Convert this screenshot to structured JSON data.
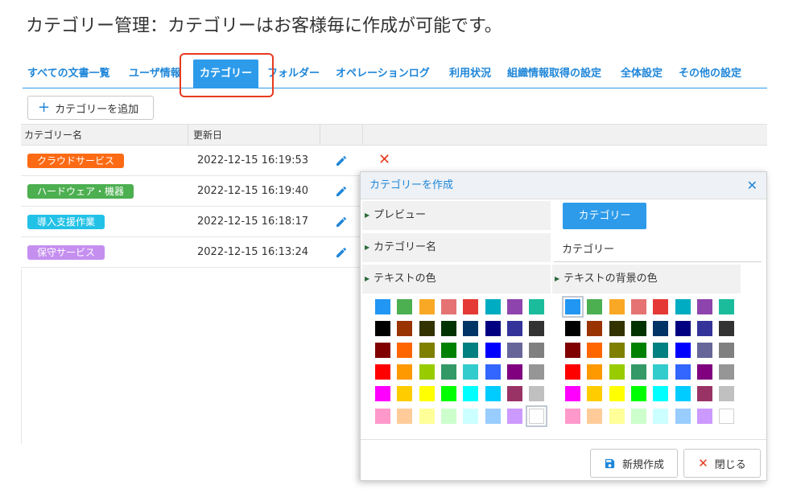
{
  "page": {
    "title": "カテゴリー管理：カテゴリーはお客様毎に作成が可能です。"
  },
  "nav": {
    "tabs": [
      {
        "label": "すべての文書一覧"
      },
      {
        "label": "ユーザ情報"
      },
      {
        "label": "カテゴリー",
        "active": true
      },
      {
        "label": "フォルダー"
      },
      {
        "label": "オペレーションログ"
      },
      {
        "label": "利用状況"
      },
      {
        "label": "組織情報取得の設定"
      },
      {
        "label": "全体設定"
      },
      {
        "label": "その他の設定"
      }
    ]
  },
  "toolbar": {
    "add_label": "カテゴリーを追加",
    "add_icon": "plus-icon"
  },
  "table": {
    "columns": [
      "カテゴリー名",
      "更新日"
    ],
    "rows": [
      {
        "name": "クラウドサービス",
        "color": "#fd6a14",
        "updated": "2022-12-15 16:19:53"
      },
      {
        "name": "ハードウェア・機器",
        "color": "#4caf50",
        "updated": "2022-12-15 16:19:40"
      },
      {
        "name": "導入支援作業",
        "color": "#22c1e6",
        "updated": "2022-12-15 16:18:17"
      },
      {
        "name": "保守サービス",
        "color": "#c58ff0",
        "updated": "2022-12-15 16:13:24"
      }
    ],
    "icons": {
      "edit": "pencil-icon",
      "delete": "close-icon"
    }
  },
  "dialog": {
    "title": "カテゴリーを作成",
    "close_icon": "close-icon",
    "preview_label": "プレビュー",
    "preview_value": "カテゴリー",
    "name_label": "カテゴリー名",
    "name_value": "カテゴリー",
    "text_color_label": "テキストの色",
    "bg_color_label": "テキストの背景の色",
    "text_color_selected": "#ffffff",
    "bg_color_selected": "#2196f3",
    "palette": [
      [
        "#2196f3",
        "#4caf50",
        "#f9a825",
        "#e57373",
        "#e53935",
        "#00acc1",
        "#8e44ad",
        "#1abc9c"
      ],
      [
        "#000000",
        "#993300",
        "#333300",
        "#003300",
        "#003366",
        "#000080",
        "#333399",
        "#333333"
      ],
      [
        "#800000",
        "#ff6600",
        "#808000",
        "#008000",
        "#008080",
        "#0000ff",
        "#666699",
        "#808080"
      ],
      [
        "#ff0000",
        "#ff9900",
        "#99cc00",
        "#339966",
        "#33cccc",
        "#3366ff",
        "#800080",
        "#969696"
      ],
      [
        "#ff00ff",
        "#ffcc00",
        "#ffff00",
        "#00ff00",
        "#00ffff",
        "#00ccff",
        "#993366",
        "#c0c0c0"
      ],
      [
        "#ff99cc",
        "#ffcc99",
        "#ffff99",
        "#ccffcc",
        "#ccffff",
        "#99ccff",
        "#cc99ff",
        "#ffffff"
      ]
    ],
    "create_label": "新規作成",
    "close_label": "閉じる",
    "create_icon": "save-icon",
    "close_button_icon": "close-icon"
  }
}
